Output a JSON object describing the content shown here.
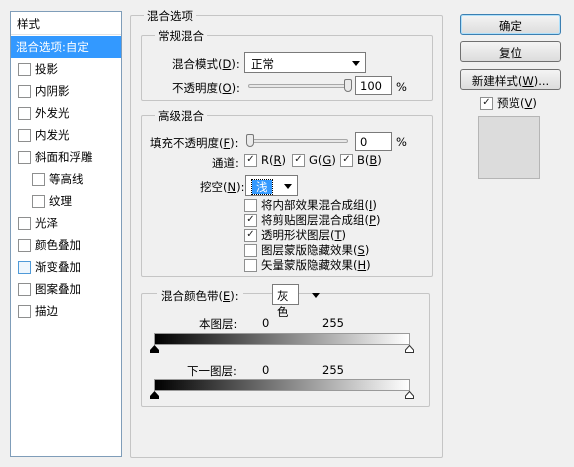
{
  "styles_panel": {
    "header": "样式",
    "items": [
      {
        "label": "混合选项:自定",
        "checkbox": false,
        "checked": false,
        "selected": true,
        "indent": false
      },
      {
        "label": "投影",
        "checkbox": true,
        "checked": false,
        "selected": false,
        "indent": false
      },
      {
        "label": "内阴影",
        "checkbox": true,
        "checked": false,
        "selected": false,
        "indent": false
      },
      {
        "label": "外发光",
        "checkbox": true,
        "checked": false,
        "selected": false,
        "indent": false
      },
      {
        "label": "内发光",
        "checkbox": true,
        "checked": false,
        "selected": false,
        "indent": false
      },
      {
        "label": "斜面和浮雕",
        "checkbox": true,
        "checked": false,
        "selected": false,
        "indent": false
      },
      {
        "label": "等高线",
        "checkbox": true,
        "checked": false,
        "selected": false,
        "indent": true
      },
      {
        "label": "纹理",
        "checkbox": true,
        "checked": false,
        "selected": false,
        "indent": true
      },
      {
        "label": "光泽",
        "checkbox": true,
        "checked": false,
        "selected": false,
        "indent": false
      },
      {
        "label": "颜色叠加",
        "checkbox": true,
        "checked": false,
        "selected": false,
        "indent": false
      },
      {
        "label": "渐变叠加",
        "checkbox": true,
        "checked": false,
        "selected": false,
        "indent": false,
        "highlight": true
      },
      {
        "label": "图案叠加",
        "checkbox": true,
        "checked": false,
        "selected": false,
        "indent": false
      },
      {
        "label": "描边",
        "checkbox": true,
        "checked": false,
        "selected": false,
        "indent": false
      }
    ]
  },
  "blending_options": {
    "title": "混合选项",
    "general": {
      "title": "常规混合",
      "blend_mode_label": "混合模式",
      "blend_mode_key": "D",
      "blend_mode_value": "正常",
      "opacity_label": "不透明度",
      "opacity_key": "O",
      "opacity_value": "100",
      "opacity_fraction": 1.0,
      "percent": "%"
    },
    "advanced": {
      "title": "高级混合",
      "fill_opacity_label": "填充不透明度",
      "fill_opacity_key": "F",
      "fill_opacity_value": "0",
      "fill_opacity_fraction": 0.0,
      "percent": "%",
      "channels_label": "通道:",
      "channels": [
        {
          "name": "R",
          "key": "R",
          "checked": true
        },
        {
          "name": "G",
          "key": "G",
          "checked": true
        },
        {
          "name": "B",
          "key": "B",
          "checked": true
        }
      ],
      "knockout_label": "挖空",
      "knockout_key": "N",
      "knockout_value": "浅",
      "options": [
        {
          "text": "将内部效果混合成组",
          "key": "I",
          "checked": false
        },
        {
          "text": "将剪贴图层混合成组",
          "key": "P",
          "checked": true
        },
        {
          "text": "透明形状图层",
          "key": "T",
          "checked": true
        },
        {
          "text": "图层蒙版隐藏效果",
          "key": "S",
          "checked": false
        },
        {
          "text": "矢量蒙版隐藏效果",
          "key": "H",
          "checked": false
        }
      ]
    },
    "blend_if": {
      "label": "混合颜色带",
      "key": "E",
      "value": "灰色",
      "this_layer_label": "本图层:",
      "this_layer_low": "0",
      "this_layer_high": "255",
      "underlying_label": "下一图层:",
      "underlying_low": "0",
      "underlying_high": "255"
    }
  },
  "buttons": {
    "ok": "确定",
    "cancel": "复位",
    "new_style_prefix": "新建样式(",
    "new_style_key": "W",
    "new_style_suffix": ")...",
    "preview_label": "预览",
    "preview_key": "V",
    "preview_checked": true
  },
  "colors": {
    "selection": "#3399ff",
    "panel_bg": "#f0f0f0",
    "preview_swatch": "#dcdcdc"
  }
}
